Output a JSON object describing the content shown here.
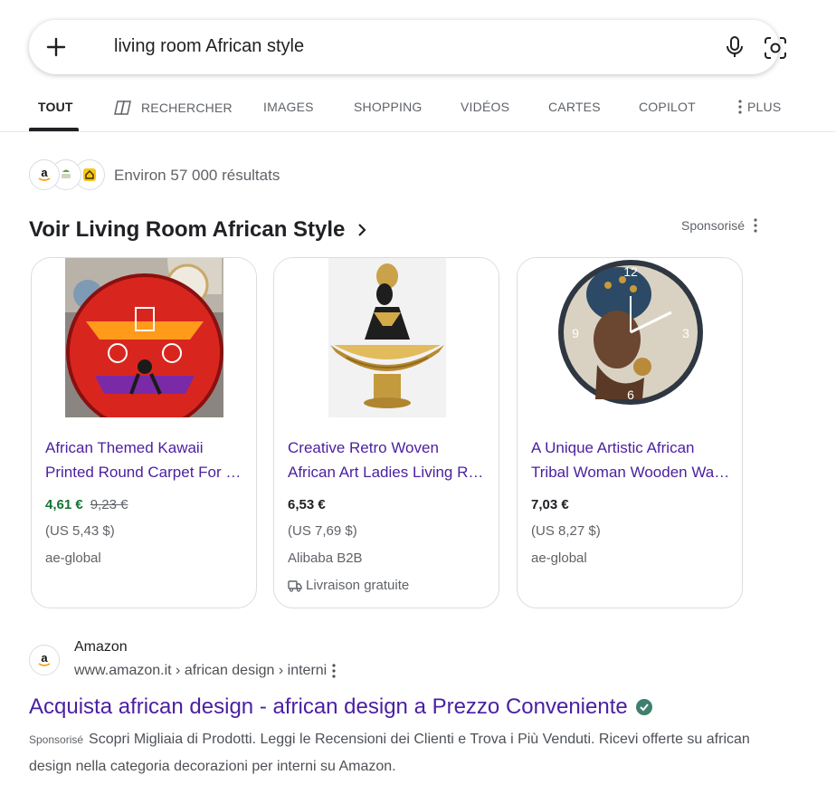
{
  "search": {
    "query": "living room African style",
    "plus_icon": "plus-icon",
    "mic_icon": "microphone-icon",
    "lens_icon": "camera-lens-icon"
  },
  "tabs": [
    {
      "label": "TOUT",
      "active": true
    },
    {
      "label": "RECHERCHER",
      "icon": "copilot-search-icon"
    },
    {
      "label": "IMAGES"
    },
    {
      "label": "SHOPPING"
    },
    {
      "label": "VIDÉOS"
    },
    {
      "label": "CARTES"
    },
    {
      "label": "COPILOT"
    },
    {
      "label": "PLUS",
      "icon": "kebab-icon"
    }
  ],
  "results": {
    "count_text": "Environ 57 000 résultats",
    "favicons": [
      "amazon-icon",
      "store-icon",
      "home-icon"
    ]
  },
  "shopping": {
    "title": "Voir Living Room African Style",
    "sponsored_label": "Sponsorisé",
    "cards": [
      {
        "title_line1": "African Themed Kawaii",
        "title_line2": "Printed Round Carpet For Living Room",
        "price": "4,61 €",
        "old_price": "9,23 €",
        "usd": "(US 5,43 $)",
        "seller": "ae-global"
      },
      {
        "title_line1": "Creative Retro Woven",
        "title_line2": "African Art Ladies Living Room",
        "price": "6,53 €",
        "usd": "(US 7,69 $)",
        "seller": "Alibaba B2B",
        "delivery": "Livraison gratuite"
      },
      {
        "title_line1": "A Unique Artistic African",
        "title_line2": "Tribal Woman Wooden Wall Clock",
        "price": "7,03 €",
        "usd": "(US 8,27 $)",
        "seller": "ae-global"
      }
    ]
  },
  "ad": {
    "site_name": "Amazon",
    "url": "www.amazon.it › african design › interni",
    "title": "Acquista african design - african design a Prezzo Conveniente",
    "sponsored_label": "Sponsorisé",
    "description": "Scopri Migliaia di Prodotti. Leggi le Recensioni dei Clienti e Trova i Più Venduti. Ricevi offerte su african design nella categoria decorazioni per interni su Amazon."
  },
  "colors": {
    "link": "#4a1fa0",
    "sale_price": "#137333",
    "verified": "#3f7f6f"
  }
}
